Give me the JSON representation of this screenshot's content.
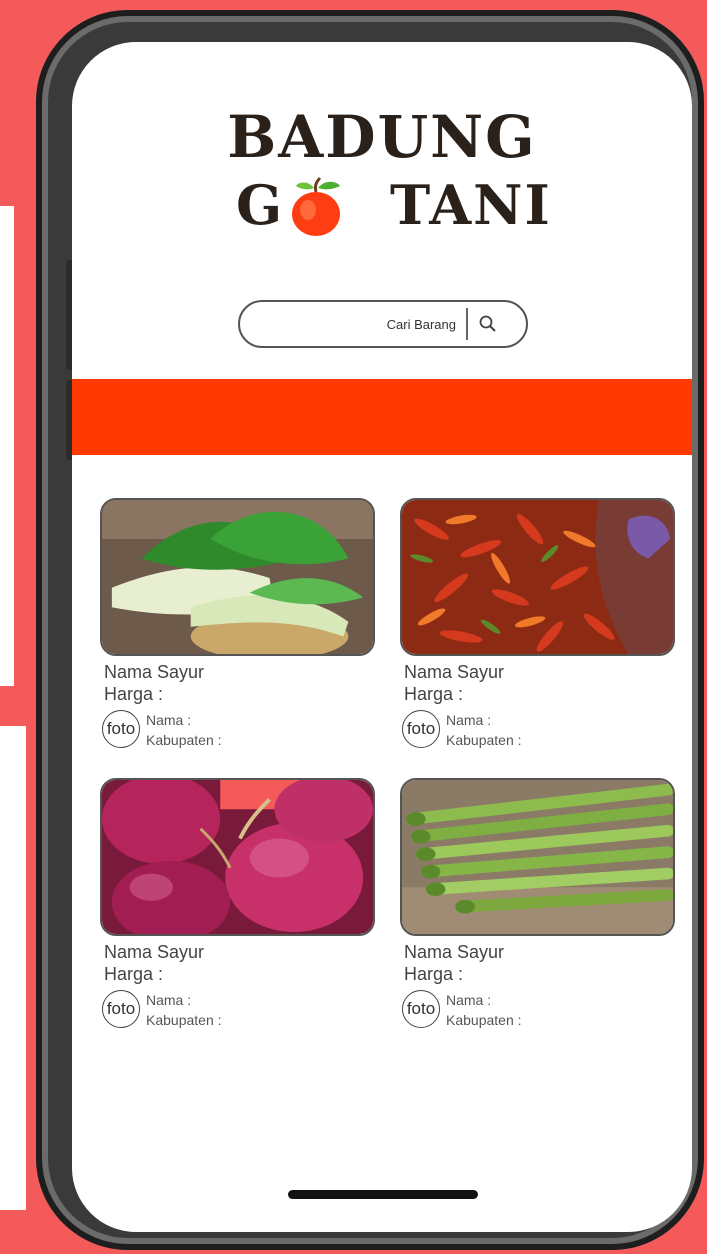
{
  "brand": {
    "line1": "BADUNG",
    "line2_left": "G",
    "line2_right": "TANI",
    "accent_color": "#ff3a00"
  },
  "search": {
    "placeholder": "Cari Barang",
    "icon": "search-icon"
  },
  "banner": {
    "color": "#ff3a00"
  },
  "products": [
    {
      "image": "bok-choy",
      "name_label": "Nama Sayur",
      "price_label": "Harga :",
      "seller_photo": "foto",
      "seller_name_label": "Nama :",
      "seller_regency_label": "Kabupaten :"
    },
    {
      "image": "red-chili",
      "name_label": "Nama Sayur",
      "price_label": "Harga :",
      "seller_photo": "foto",
      "seller_name_label": "Nama :",
      "seller_regency_label": "Kabupaten :"
    },
    {
      "image": "shallot",
      "name_label": "Nama Sayur",
      "price_label": "Harga :",
      "seller_photo": "foto",
      "seller_name_label": "Nama :",
      "seller_regency_label": "Kabupaten :"
    },
    {
      "image": "asparagus",
      "name_label": "Nama Sayur",
      "price_label": "Harga :",
      "seller_photo": "foto",
      "seller_name_label": "Nama :",
      "seller_regency_label": "Kabupaten :"
    }
  ]
}
